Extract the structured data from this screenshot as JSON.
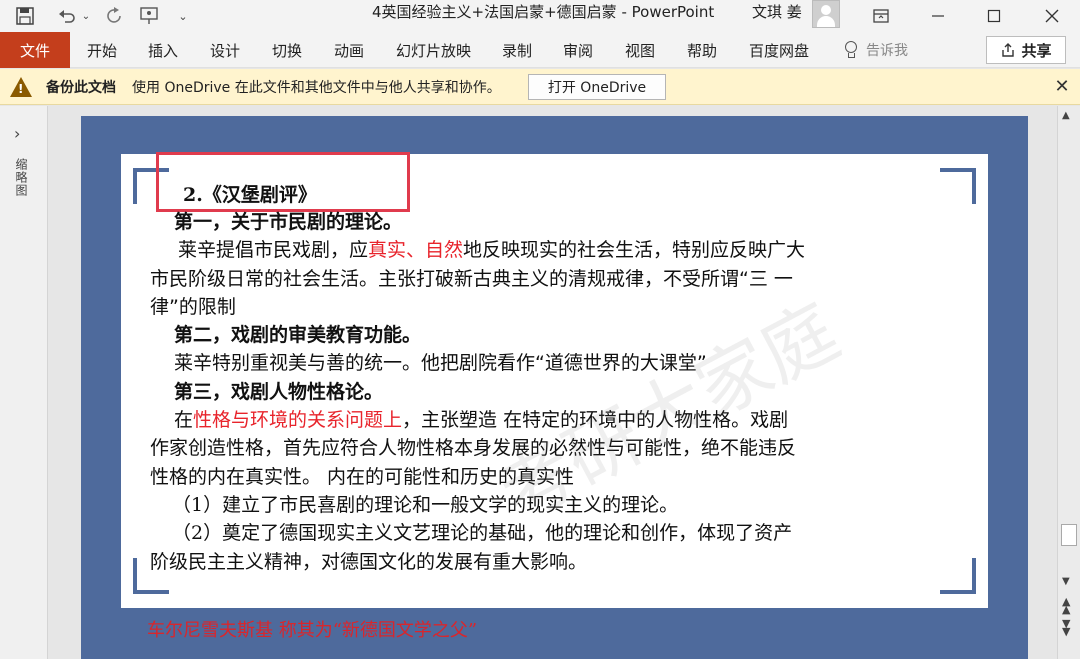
{
  "titlebar": {
    "title": "4英国经验主义+法国启蒙+德国启蒙  -  PowerPoint",
    "user": "文琪 姜"
  },
  "ribbon": {
    "file": "文件",
    "tabs": [
      "开始",
      "插入",
      "设计",
      "切换",
      "动画",
      "幻灯片放映",
      "录制",
      "审阅",
      "视图",
      "帮助",
      "百度网盘"
    ],
    "tell_me": "告诉我",
    "share": "共享"
  },
  "infobar": {
    "bold": "备份此文档",
    "text": "使用 OneDrive 在此文件和其他文件中与他人共享和协作。",
    "button": "打开 OneDrive"
  },
  "left_pane": {
    "label": "缩略图"
  },
  "slide": {
    "title": "2.《汉堡剧评》",
    "lines": {
      "l1": "第一，关于市民剧的理论。",
      "l2a": "莱辛提倡市民戏剧，应",
      "l2b": "真实、自然",
      "l2c": "地反映现实的社会生活，特别应反映广大",
      "l3": "市民阶级日常的社会生活。主张打破新古典主义的清规戒律，不受所谓“三 一",
      "l4": "律”的限制",
      "l5": "第二，戏剧的审美教育功能。",
      "l6": "莱辛特别重视美与善的统一。他把剧院看作“道德世界的大课堂”",
      "l7": "第三，戏剧人物性格论。",
      "l8a": "在",
      "l8b": "性格与环境的关系问题上",
      "l8c": "，主张塑造  在特定的环境中的人物性格。戏剧",
      "l9": "作家创造性格，首先应符合人物性格本身发展的必然性与可能性，绝不能违反",
      "l10": "性格的内在真实性。 内在的可能性和历史的真实性",
      "l11": "（1）建立了市民喜剧的理论和一般文学的现实主义的理论。",
      "l12": "（2）奠定了德国现实主义文艺理论的基础，他的理论和创作，体现了资产",
      "l13": "阶级民主主义精神，对德国文化的发展有重大影响。"
    },
    "footer": "车尔尼雪夫斯基  称其为“新德国文学之父”",
    "watermark": "考研大家庭"
  },
  "colors": {
    "file_tab": "#c43e1c",
    "slide_border": "#4e6a9c",
    "emphasis_red": "#e8242c",
    "highlight_box": "#e03b4d",
    "infobar_bg": "#fff4ce"
  }
}
